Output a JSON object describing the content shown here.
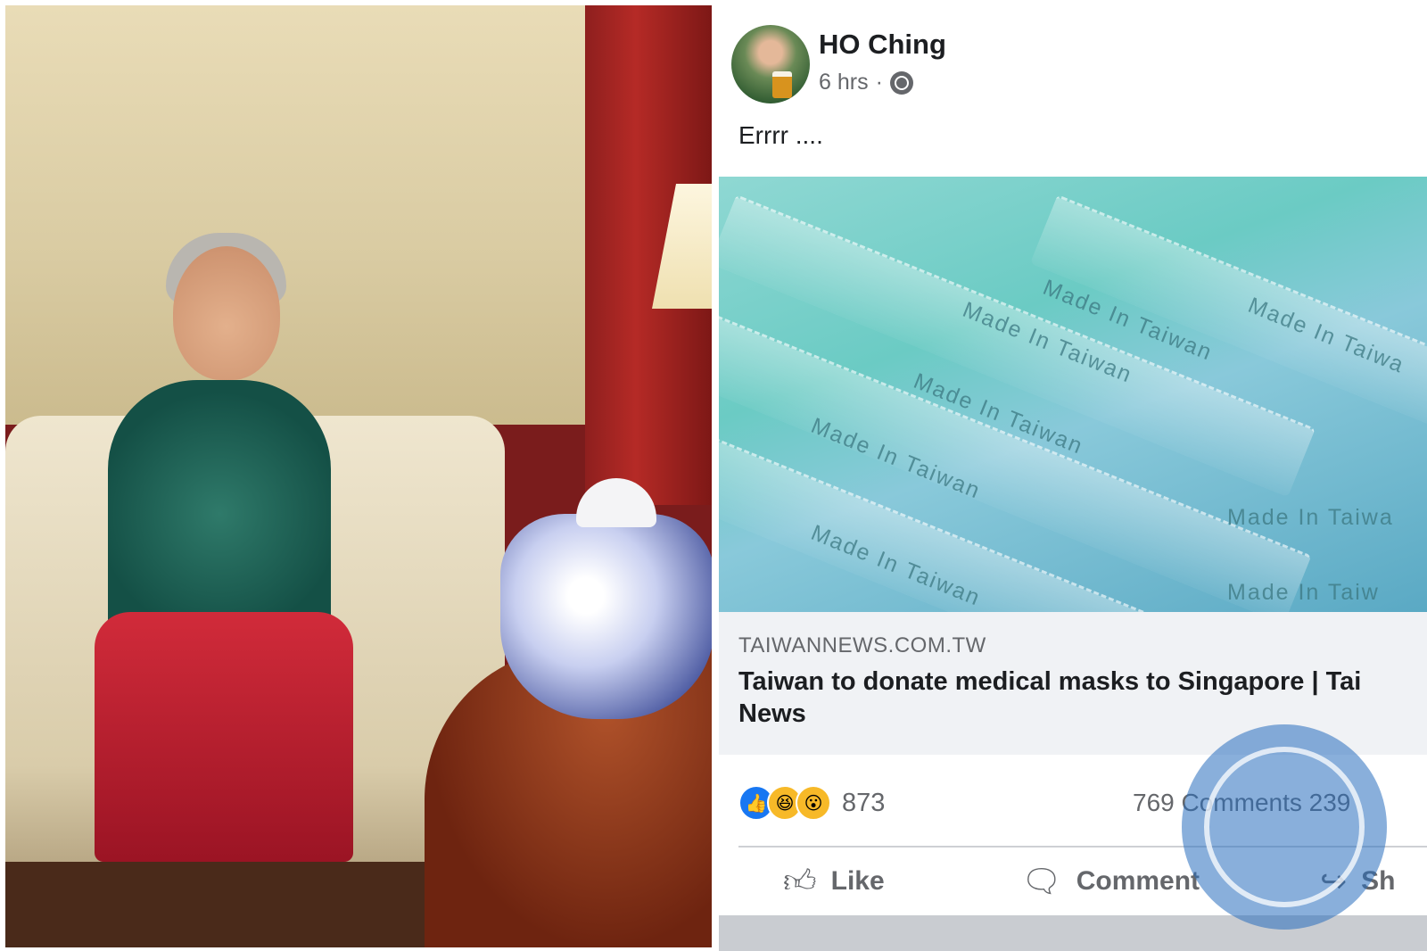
{
  "post": {
    "author": "HO Ching",
    "time": "6 hrs",
    "separator": "·",
    "status_text": "Errrr ....",
    "link": {
      "domain": "TAIWANNEWS.COM.TW",
      "headline": "Taiwan to donate medical masks to Singapore | Tai",
      "headline_line2": "News",
      "image_text": [
        "Made In Taiwan",
        "Made In Taiwan",
        "Made In Taiwan",
        "Made In Taiwan",
        "Made In Taiwan",
        "Made In Taiwa",
        "Made In Taiwa",
        "Made In Taiw"
      ]
    },
    "reactions": {
      "icons": [
        "like-icon",
        "haha-icon",
        "wow-icon"
      ],
      "count": "873"
    },
    "comments": "769 Comments",
    "shares": "239",
    "actions": {
      "like": "Like",
      "comment": "Comment",
      "share": "Sh"
    }
  },
  "colors": {
    "accent": "#1877f2",
    "text": "#1c1e21",
    "muted": "#65676b",
    "link_bg": "#f0f2f5",
    "watermark": "#2f6ebe"
  }
}
